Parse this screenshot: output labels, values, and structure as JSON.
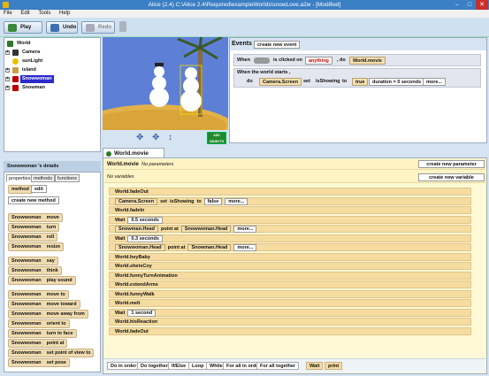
{
  "window": {
    "title": "Alice (2.4) C:\\Alice 2.4\\Required\\exampleWorlds\\snowLove.a2w - [Modified]",
    "min": "–",
    "max": "□",
    "close": "✕"
  },
  "menu": [
    "File",
    "Edit",
    "Tools",
    "Help"
  ],
  "toolbar": {
    "play": "Play",
    "undo": "Undo",
    "redo": "Redo"
  },
  "tree": [
    {
      "label": "World",
      "sign": "",
      "icon": "globe-icon",
      "color": "#2a7a2a"
    },
    {
      "label": "Camera",
      "sign": "+",
      "icon": "camera-icon",
      "color": "#333"
    },
    {
      "label": "sunLight",
      "sign": "",
      "icon": "light-icon",
      "color": "#e8c000"
    },
    {
      "label": "island",
      "sign": "+",
      "icon": "island-icon",
      "color": "#c8a040"
    },
    {
      "label": "Snowwoman",
      "sign": "+",
      "icon": "snowman-icon",
      "color": "#b00"
    },
    {
      "label": "Snowman",
      "sign": "+",
      "icon": "snowman-icon",
      "color": "#b00"
    }
  ],
  "scene": {
    "add_objects": "ADD OBJECTS"
  },
  "events": {
    "title": "Events",
    "create_btn": "create new event",
    "e1": {
      "when": "When",
      "is_clicked": "is clicked on",
      "anything": "anything",
      "do": ", do",
      "action": "World.movie"
    },
    "e2": {
      "when": "When the world starts ,",
      "do": "do",
      "target": "Camera.Screen",
      "set": "set",
      "prop": "isShowing",
      "to": "to",
      "val": "true",
      "dur": "duration = 0 seconds",
      "more": "more..."
    }
  },
  "details": {
    "header": "Snowwoman 's details",
    "tabs": [
      "properties",
      "methods",
      "functions"
    ],
    "method_lbl": "method",
    "edit": "edit",
    "create": "create new method",
    "methods": [
      {
        "obj": "Snowwoman",
        "name": "move"
      },
      {
        "obj": "Snowwoman",
        "name": "turn"
      },
      {
        "obj": "Snowwoman",
        "name": "roll"
      },
      {
        "obj": "Snowwoman",
        "name": "resize"
      },
      {
        "obj": "Snowwoman",
        "name": "say"
      },
      {
        "obj": "Snowwoman",
        "name": "think"
      },
      {
        "obj": "Snowwoman",
        "name": "play sound"
      },
      {
        "obj": "Snowwoman",
        "name": "move to"
      },
      {
        "obj": "Snowwoman",
        "name": "move  toward"
      },
      {
        "obj": "Snowwoman",
        "name": "move  away from"
      },
      {
        "obj": "Snowwoman",
        "name": "orient to"
      },
      {
        "obj": "Snowwoman",
        "name": "turn to face"
      },
      {
        "obj": "Snowwoman",
        "name": "point at"
      },
      {
        "obj": "Snowwoman",
        "name": "set point of view to"
      },
      {
        "obj": "Snowwoman",
        "name": "set pose"
      }
    ]
  },
  "editor": {
    "tab": "World.movie",
    "header": "World.movie",
    "no_params": "No parameters",
    "create_param": "create new parameter",
    "no_vars": "No variables",
    "create_var": "create new variable",
    "rows": [
      [
        "World.fadeOut"
      ],
      [
        "Camera.Screen",
        "set",
        "isShowing",
        "to",
        "false",
        "more..."
      ],
      [
        "World.fadeIn"
      ],
      [
        "Wait",
        "0.5 seconds"
      ],
      [
        "Snowman.Head",
        "point at",
        "Snowwoman.Head",
        "more..."
      ],
      [
        "Wait",
        "0.3 seconds"
      ],
      [
        "Snowwoman.Head",
        "point at",
        "Snowman.Head",
        "more..."
      ],
      [
        "World.heyBaby"
      ],
      [
        "World.shetsCoy"
      ],
      [
        "World.funnyTurnAnimation"
      ],
      [
        "World.extendArms"
      ],
      [
        "World.funnyWalk"
      ],
      [
        "World.melt"
      ],
      [
        "Wait",
        "1 second"
      ],
      [
        "World.hisReaction"
      ],
      [
        "World.fadeOut"
      ]
    ],
    "bottom": [
      "Do in order",
      "Do together",
      "If/Else",
      "Loop",
      "While",
      "For all in order",
      "For all together",
      "Wait",
      "print"
    ]
  }
}
